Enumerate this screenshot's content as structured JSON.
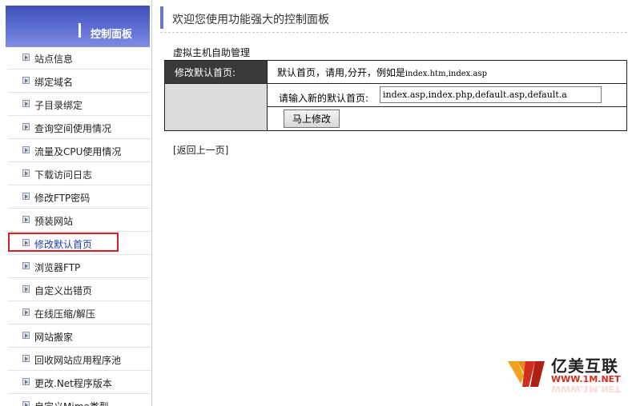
{
  "sidebar": {
    "title": "控制面板",
    "items": [
      {
        "label": "站点信息"
      },
      {
        "label": "绑定域名"
      },
      {
        "label": "子目录绑定"
      },
      {
        "label": "查询空间使用情况"
      },
      {
        "label": "流量及CPU使用情况"
      },
      {
        "label": "下载访问日志"
      },
      {
        "label": "修改FTP密码"
      },
      {
        "label": "预装网站"
      },
      {
        "label": "修改默认首页"
      },
      {
        "label": "浏览器FTP"
      },
      {
        "label": "自定义出错页"
      },
      {
        "label": "在线压缩/解压"
      },
      {
        "label": "网站搬家"
      },
      {
        "label": "回收网站应用程序池"
      },
      {
        "label": "更改.Net程序版本"
      },
      {
        "label": "自定义Mime类型"
      }
    ],
    "active_index": 8,
    "highlight_color": "#d61f26"
  },
  "header": {
    "title": "欢迎您使用功能强大的控制面板"
  },
  "section": {
    "title": "虚拟主机自助管理"
  },
  "form": {
    "row_label": "修改默认首页:",
    "info_prefix": "默认首页，请用,分开，例如是",
    "info_example": "index.htm,index.asp",
    "new_label": "请输入新的默认首页:",
    "new_value": "index.asp,index.php,default.asp,default.a",
    "submit_label": "马上修改"
  },
  "back_link": "[返回上一页]",
  "watermark": {
    "brand": "亿美互联",
    "url": "WWW.1M.NET",
    "colors": {
      "logo_orange": "#f0a21b",
      "logo_red": "#d12c1d"
    }
  }
}
